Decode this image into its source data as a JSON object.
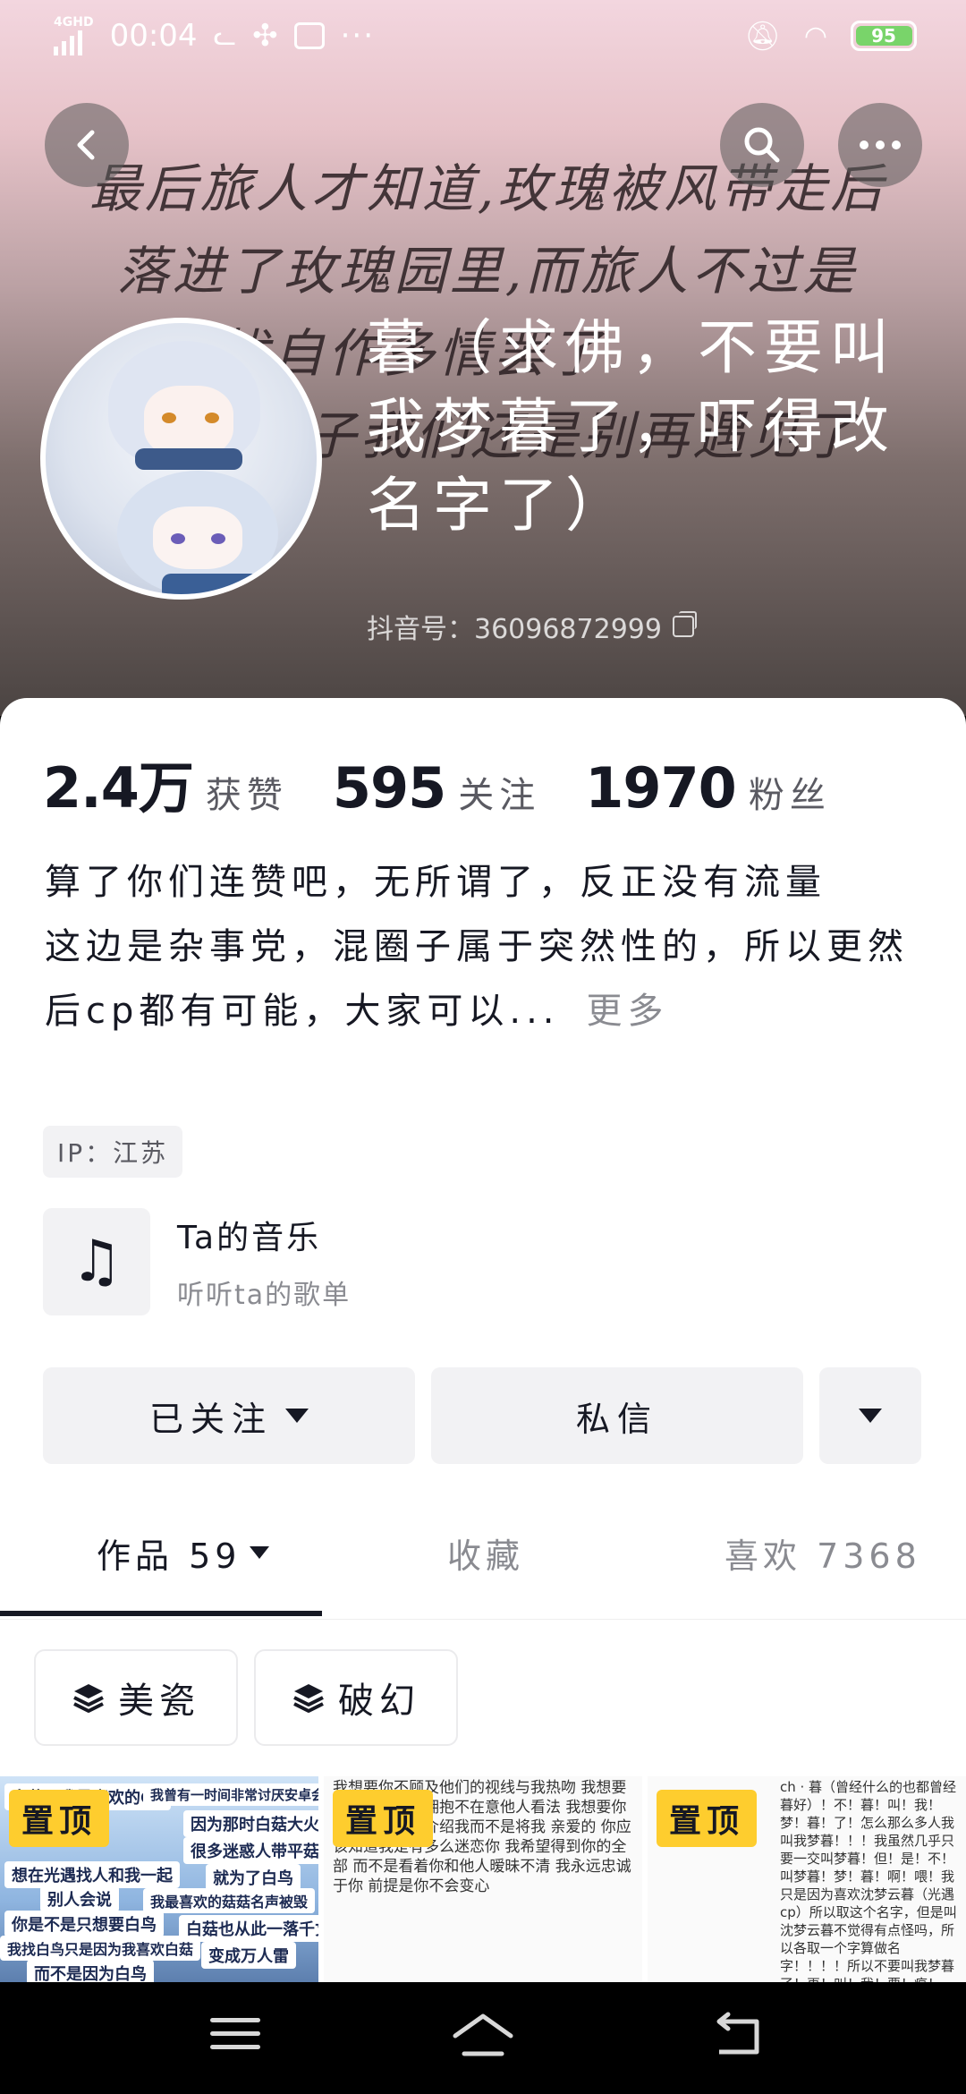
{
  "status_bar": {
    "network": "4GHD",
    "time": "00:04",
    "battery": "95"
  },
  "banner": {
    "poem_lines": [
      "最后旅人才知道,玫瑰被风带走后",
      "落进了玫瑰园里,而旅人不过是",
      "人忧自作多情罢了",
      "子我们还是别再遇见了"
    ]
  },
  "profile": {
    "nickname": "暮（求佛，不要叫我梦暮了，吓得改名字了）",
    "douyin_id": "抖音号：36096872999"
  },
  "stats": [
    {
      "num": "2.4万",
      "label": "获赞"
    },
    {
      "num": "595",
      "label": "关注"
    },
    {
      "num": "1970",
      "label": "粉丝"
    }
  ],
  "bio": {
    "line1": "算了你们连赞吧，无所谓了，反正没有流量",
    "line2": "这边是杂事党，混圈子属于突然性的，所以更然后cp都有可能，大家可以...",
    "more": "更多"
  },
  "ip": "IP：江苏",
  "music": {
    "title": "Ta的音乐",
    "subtitle": "听听ta的歌单"
  },
  "actions": {
    "follow": "已关注",
    "message": "私信"
  },
  "tabs": {
    "works": "作品 59",
    "favorites": "收藏",
    "likes": "喜欢 7368"
  },
  "collections": [
    "美瓷",
    "破幻"
  ],
  "pin_label": "置顶",
  "thumb1_lines": [
    "白菇是我最喜欢的CP",
    "我曾有一时间非常讨厌安卓会",
    "因为那时白菇大火",
    "很多迷惑人带平菇",
    "想在光遇找人和我一起",
    "就为了白鸟",
    "别人会说",
    "我最喜欢的菇菇名声被毁",
    "你是不是只想要白鸟",
    "白菇也从此一落千丈",
    "我找白鸟只是因为我喜欢白菇",
    "变成万人雷",
    "而不是因为白鸟"
  ],
  "thumb2_text": "我想要你不顾及他们的视线与我热吻 我想要你在众人面前拥抱不在意他人看法 我想要你在他人面前大介绍我而不是将我 亲爱的 你应该知道我是有多么迷恋你 我希望得到你的全部 而不是看着你和他人暧昧不清 我永远忠诚于你 前提是你不会变心",
  "thumb3_text": "ch · 暮（曾经什么的也都曾经暮好）！不！暮！叫！我！梦！暮！了！怎么那么多人我叫我梦暮！！！我虽然几乎只要一交叫梦暮！但！是！不！叫梦暮！梦！暮！啊！喂！我只是因为喜欢沈梦云暮（光遇cp）所以取这个名字，但是叫沈梦云暮不觉得有点怪吗，所以各取一个字算做名字！！！！所以不要叫我梦暮了！再！叫！我！要！疯！掉！了！ 混的圈子：蛋仔，第五，光遇，ch，省拟，cp",
  "icons": {
    "back": "back-arrow-icon",
    "search": "search-icon",
    "more": "more-dots-icon",
    "music": "music-note-icon",
    "copy": "copy-icon",
    "layers": "layers-icon"
  },
  "colors": {
    "pin_yellow": "#fecd2e",
    "battery_green": "#79d46a",
    "text_primary": "#161823",
    "text_secondary": "#8a8b91"
  }
}
